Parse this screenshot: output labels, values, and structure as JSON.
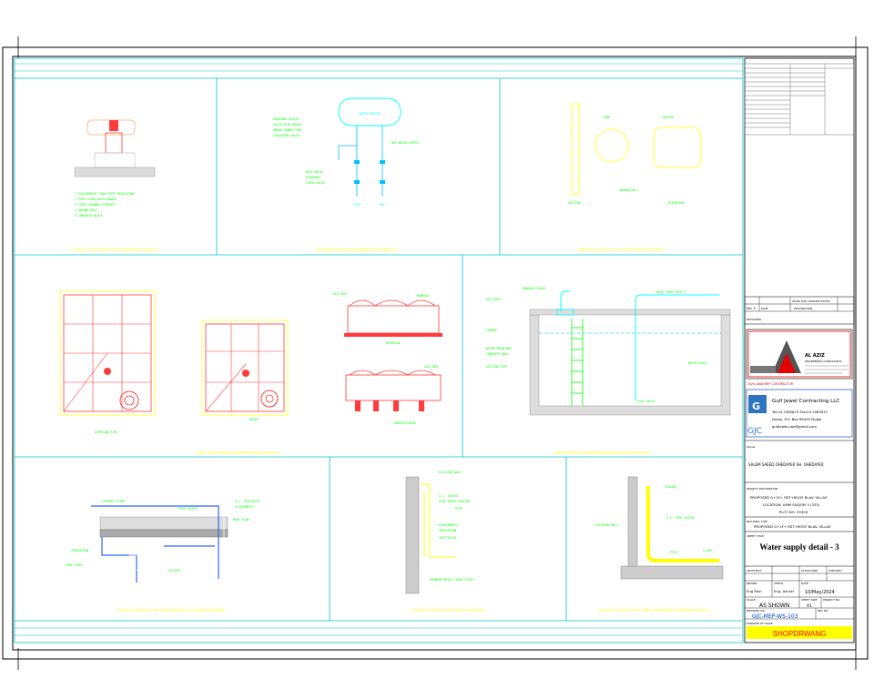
{
  "drawing": {
    "panels": [
      {
        "id": "p1",
        "title": "TYPICAL WATER PIPE SUPPORT DETAIL"
      },
      {
        "id": "p2",
        "title": "WATER HEATER CONNECTION DETAIL"
      },
      {
        "id": "p3",
        "title": "INSTALLATION OF THE WATER HEATER"
      },
      {
        "id": "p4",
        "title": "GRP SECTIONAL WATER TANK DETAIL"
      },
      {
        "id": "p5",
        "title": "SECTION OF UNDERGROUND WATER TANK"
      },
      {
        "id": "p6",
        "title": "TYPICAL DETAIL OF PIPE INSTALLATION ON ROOF"
      },
      {
        "id": "p7",
        "title": "TYPICAL DETAIL OF WALL SLEEVE"
      },
      {
        "id": "p8",
        "title": "TYPICAL DETAIL OF PIPE PASSING THROUGH WALL"
      }
    ],
    "labels": {
      "water_heater": "WATER HEATER",
      "cold": "COLD",
      "hot": "HOT",
      "tank": "TANK",
      "elevation": "ELEVATION"
    }
  },
  "title_block": {
    "consultant_name": "AL AZIZ",
    "consultant_sub": "ENGINEERING CONSULTANTS",
    "contractor_heading": "CIVIL AND MEP CONTRACTOR",
    "contractor_logo": "GJC",
    "contractor_name": "Gulf Jewel Contracting LLC",
    "contractor_tel": "Tel:04 2585873 Fax:04 2585937",
    "contractor_addr": "Dubai, P.O. Box 89493 Dubai",
    "contractor_email": "gulfjewel.uae@gmail.com",
    "owner_label": "Owner",
    "owner_name": "SALEM SAEED OHEDAYER SH. OHEDAYER",
    "project_label": "PROJECT DESCRIPTION",
    "project_desc_1": "PROPOSED G+1F+ RST+ROOF BLAV. VILLAS",
    "project_desc_2": "LOCATION: UMM SUQEIM 3 (335)",
    "project_desc_3": "PLOT NO: 3530X",
    "building_label": "BUILDING TYPE",
    "building_type": "PROPOSED G+1F+ RST+ROOF BLAV. VILLAS",
    "sheet_title_label": "SHEET TITLE",
    "sheet_title": "Water supply detail - 3",
    "arch_label": "ARCHITECT",
    "structure_label": "STRUCTURE",
    "checker_label": "CHECKED",
    "drawn_label": "DRAWN",
    "drawn_by": "Eng Ravi",
    "checked_label": "CHECK",
    "checked_by": "Eng. Ashraf",
    "date_label": "DATE",
    "date": "10/May/2024",
    "scale_label": "SCALE",
    "scale": "AS SHOWN",
    "sheet_size_label": "SHEET SIZE",
    "sheet_size": "A1",
    "project_no_label": "PROJECT NO",
    "drawing_no_label": "DRAWING NO",
    "drawing_no": "GJC-MEP-WS-103",
    "rev_label": "REV NO",
    "purpose_label": "PURPOSE OF ISSUE",
    "purpose": "SHOPDRWANG",
    "rev_table_head_date": "DATE",
    "rev_table_head_desc": "DESCRIPTION",
    "rev_row_no": "Rev. 0",
    "rev_row_desc": "ISSUE FOR CONSTRUCTION",
    "rev_notes_label": "REVISIONS"
  },
  "colors": {
    "frame": "#000000",
    "panel_border": "#00c8c8",
    "structure": "#ff3b3b",
    "note": "#00ff00",
    "pipe": "#00bfff",
    "title": "#ffff00",
    "purpose_bg": "#ffff00",
    "purpose_text": "#ff0000",
    "drawing_no_text": "#0033cc"
  }
}
